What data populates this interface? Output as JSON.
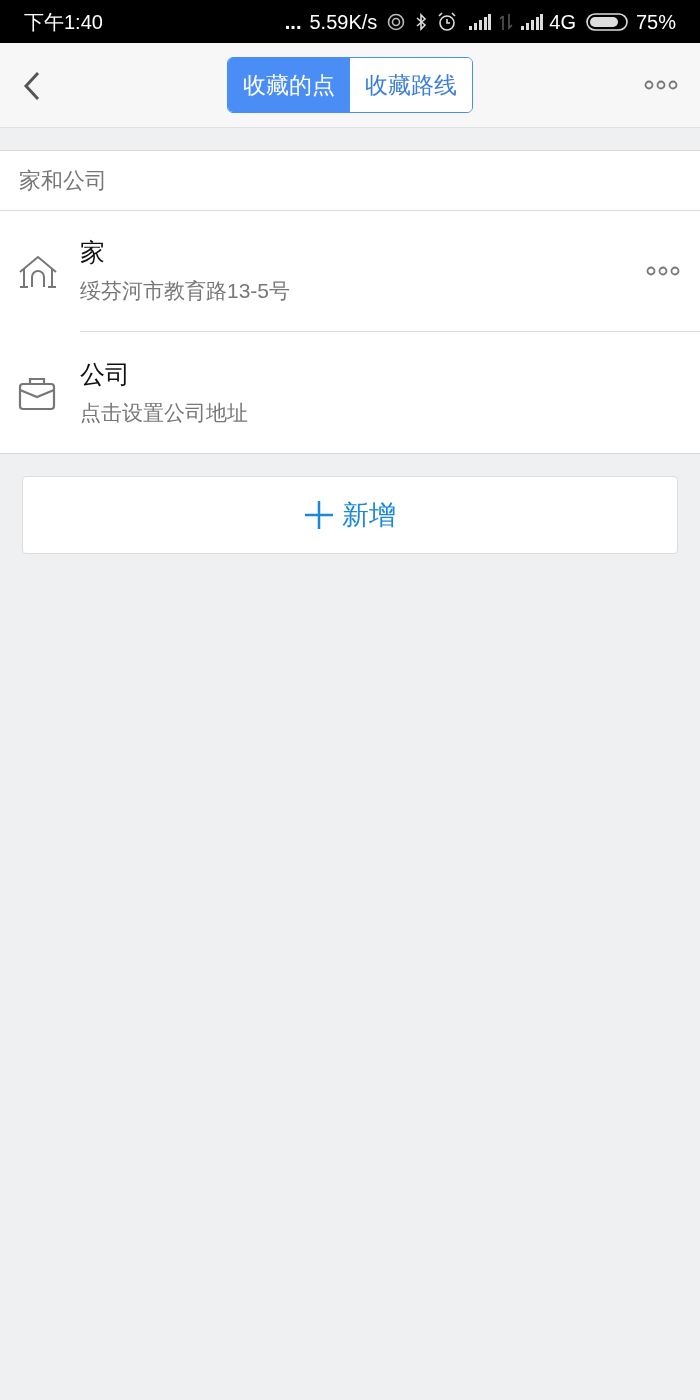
{
  "status_bar": {
    "time": "下午1:40",
    "dots": "...",
    "speed": "5.59K/s",
    "network": "4G",
    "battery": "75%"
  },
  "header": {
    "tabs": [
      {
        "label": "收藏的点",
        "selected": true
      },
      {
        "label": "收藏路线",
        "selected": false
      }
    ]
  },
  "section": {
    "title": "家和公司",
    "items": [
      {
        "kind": "home",
        "title": "家",
        "subtitle": "绥芬河市教育路13-5号",
        "has_menu": true
      },
      {
        "kind": "office",
        "title": "公司",
        "subtitle": "点击设置公司地址",
        "has_menu": false
      }
    ]
  },
  "add_button": {
    "label": "新增"
  }
}
